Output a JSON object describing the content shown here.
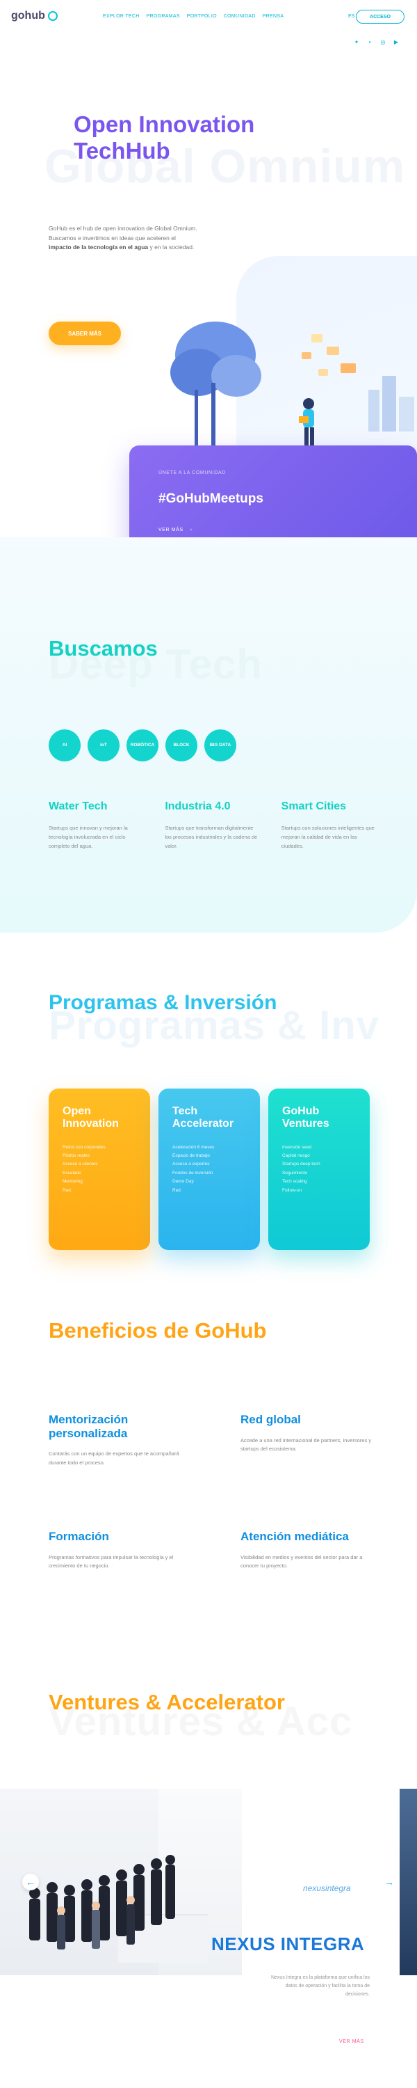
{
  "header": {
    "logo_text": "gohub",
    "nav": [
      "EXPLOR TECH",
      "PROGRAMAS",
      "PORTFOLIO",
      "COMUNIDAD",
      "PRENSA"
    ],
    "lang": "ES",
    "access_label": "ACCESO",
    "social_icons": [
      "twitter-icon",
      "linkedin-icon",
      "instagram-icon",
      "youtube-icon"
    ]
  },
  "hero": {
    "bg_word": "Global Omnium",
    "title_line1": "Open Innovation",
    "title_line2": "TechHub",
    "paragraph_pre": "GoHub es el hub de open innovation de Global Omnium. Buscamos e invertimos en ideas que aceleren el ",
    "paragraph_bold": "impacto de la tecnología en el agua",
    "paragraph_post": " y en la sociedad.",
    "cta_label": "SABER MÁS"
  },
  "meetup": {
    "kicker": "ÚNETE A LA COMUNIDAD",
    "tag": "#GoHubMeetups",
    "more_label": "VER MÁS"
  },
  "seek": {
    "title": "Buscamos",
    "bg_word": "Deep Tech",
    "circles": [
      "AI",
      "IoT",
      "ROBÓTICA",
      "BLOCK",
      "BIG DATA"
    ],
    "columns": [
      {
        "title": "Water Tech",
        "text": "Startups que innovan y mejoran la tecnología involucrada en el ciclo completo del agua."
      },
      {
        "title": "Industria 4.0",
        "text": "Startups que transforman digitalmente los procesos industriales y la cadena de valor."
      },
      {
        "title": "Smart Cities",
        "text": "Startups con soluciones inteligentes que mejoran la calidad de vida en las ciudades."
      }
    ]
  },
  "programs": {
    "title": "Programas & Inversión",
    "bg_word": "Programas & Inv",
    "cards": [
      {
        "title": "Open Innovation",
        "items": [
          "Retos con corporates",
          "Pilotos reales",
          "Acceso a clientes",
          "Escalado",
          "Mentoring",
          "Red"
        ]
      },
      {
        "title": "Tech Accelerator",
        "items": [
          "Aceleración 6 meses",
          "Espacio de trabajo",
          "Acceso a expertos",
          "Fondos de inversión",
          "Demo Day",
          "Red"
        ]
      },
      {
        "title": "GoHub Ventures",
        "items": [
          "Inversión seed",
          "Capital riesgo",
          "Startups deep tech",
          "Seguimiento",
          "Tech scaling",
          "Follow-on"
        ]
      }
    ]
  },
  "benefits": {
    "title": "Beneficios de GoHub",
    "items": [
      {
        "title": "Mentorización personalizada",
        "text": "Contarás con un equipo de expertos que te acompañará durante todo el proceso."
      },
      {
        "title": "Red global",
        "text": "Accede a una red internacional de partners, inversores y startups del ecosistema."
      },
      {
        "title": "Formación",
        "text": "Programas formativos para impulsar la tecnología y el crecimiento de tu negocio."
      },
      {
        "title": "Atención mediática",
        "text": "Visibilidad en medios y eventos del sector para dar a conocer tu proyecto."
      }
    ]
  },
  "ventures": {
    "title": "Ventures & Accelerator",
    "bg_word": "Ventures & Acc",
    "handle": "nexusintegra",
    "name": "NEXUS INTEGRA",
    "text": "Nexus Integra es la plataforma que unifica los datos de operación y facilita la toma de decisiones.",
    "more_label": "VER MÁS"
  },
  "colors": {
    "purple": "#7a55ee",
    "teal": "#13d2c4",
    "blue": "#2ec3ee",
    "orange": "#ffa415",
    "deep_blue": "#1a78d8"
  }
}
